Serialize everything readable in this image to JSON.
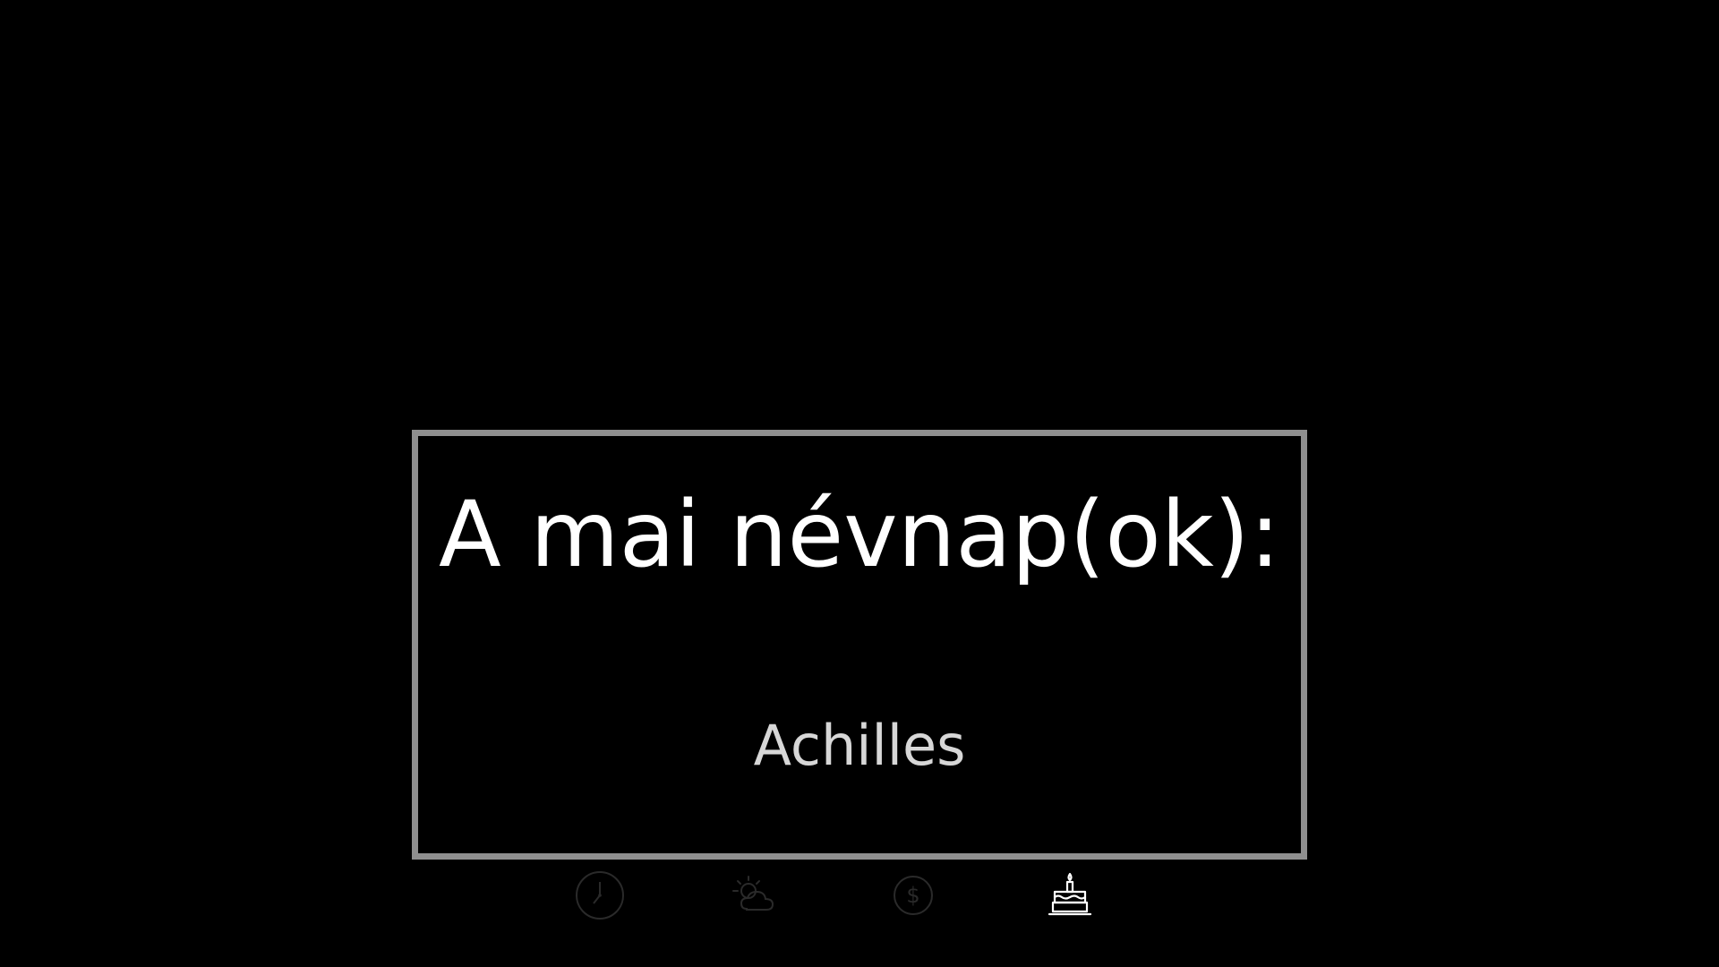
{
  "nameday": {
    "title": "A mai névnap(ok):",
    "name": "Achilles"
  },
  "nav": {
    "items": [
      {
        "icon": "clock-icon",
        "active": false
      },
      {
        "icon": "weather-icon",
        "active": false
      },
      {
        "icon": "dollar-icon",
        "active": false
      },
      {
        "icon": "birthday-cake-icon",
        "active": true
      }
    ]
  },
  "colors": {
    "background": "#000000",
    "card_border": "#8f8f8f",
    "title": "#ffffff",
    "name": "#d7d7d7",
    "icon_inactive": "#2a2a2a",
    "icon_active": "#ffffff"
  }
}
